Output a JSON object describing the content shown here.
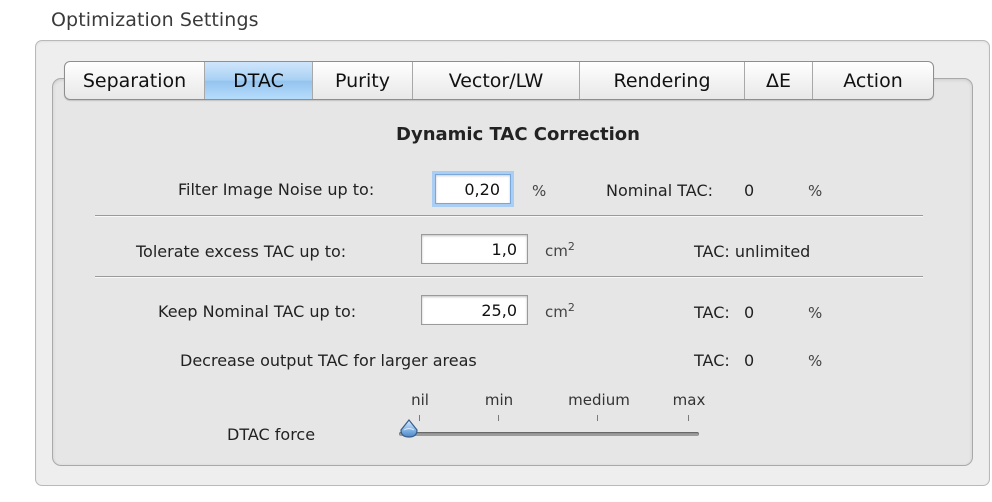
{
  "group": {
    "title": "Optimization Settings"
  },
  "tabs": [
    {
      "label": "Separation",
      "active": false
    },
    {
      "label": "DTAC",
      "active": true
    },
    {
      "label": "Purity",
      "active": false
    },
    {
      "label": "Vector/LW",
      "active": false
    },
    {
      "label": "Rendering",
      "active": false
    },
    {
      "label": "ΔE",
      "active": false
    },
    {
      "label": "Action",
      "active": false
    }
  ],
  "panel": {
    "title": "Dynamic TAC Correction",
    "filter_noise": {
      "label": "Filter Image Noise up to:",
      "value": "0,20",
      "unit": "%"
    },
    "nominal_tac": {
      "label": "Nominal TAC:",
      "value": "0",
      "unit": "%"
    },
    "tolerate_excess": {
      "label": "Tolerate excess TAC up to:",
      "value": "1,0",
      "unit": "cm",
      "unit_sup": "2",
      "tac_text": "TAC: unlimited"
    },
    "keep_nominal": {
      "label": "Keep Nominal TAC up to:",
      "value": "25,0",
      "unit": "cm",
      "unit_sup": "2",
      "tac_label": "TAC:",
      "tac_value": "0",
      "tac_unit": "%"
    },
    "decrease_output": {
      "label": "Decrease output TAC for larger areas",
      "tac_label": "TAC:",
      "tac_value": "0",
      "tac_unit": "%"
    },
    "dtac_force": {
      "label": "DTAC force",
      "ticks": [
        "nil",
        "min",
        "medium",
        "max"
      ],
      "value": "nil"
    }
  }
}
